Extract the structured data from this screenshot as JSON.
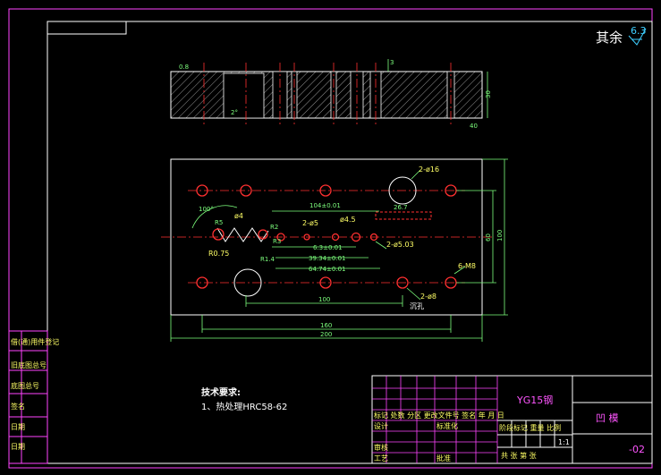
{
  "roughness": {
    "label": "其余",
    "value": "6.3"
  },
  "section_view": {
    "labels": {
      "flatness": "0.8",
      "chamfer": "2°",
      "depth": "3",
      "thickness": "30",
      "width": "40"
    }
  },
  "plan_view": {
    "labels": {
      "holes_right_top": "2-ø16",
      "center_pitch": "104±0.01",
      "slot_len": "26.7",
      "angle": "100°",
      "die_dia": "ø4",
      "r_top": "R5",
      "r_outer": "R0.75",
      "r_mid": "R2",
      "r_r3": "R3",
      "r_r14": "R1.4",
      "pin_holes": "2-ø5",
      "punch_hole": "ø4.5",
      "pin_holes2": "2-ø5.03",
      "dim_a": "6.3±0.01",
      "dim_b": "39.34±0.01",
      "dim_c": "64.74±0.01",
      "screw_holes": "6-M8",
      "dowel_holes": "2-ø8",
      "dim_100": "100",
      "dim_160": "160",
      "dim_200": "200",
      "height_60": "60",
      "height_100": "100",
      "note_small": "沉孔"
    }
  },
  "tech_req": {
    "title": "技术要求:",
    "item1": "1、热处理HRC58-62"
  },
  "left_table": {
    "rows": [
      "借(通)用件登记",
      "旧底图总号",
      "底图总号",
      "签名",
      "日期",
      "日期"
    ]
  },
  "title_block": {
    "material": "YG15钢",
    "drawing_name": "凹 模",
    "drawing_no": "-02",
    "scale": "1:1",
    "row_header": "标记 处数 分区 更改文件号 签名 年 月 日",
    "design": "设计",
    "standardize": "标准化",
    "check": "审核",
    "approve": "批准",
    "process": "工艺",
    "stage_header": "阶段标记 重量 比例",
    "sheet": "共 张 第 张"
  }
}
